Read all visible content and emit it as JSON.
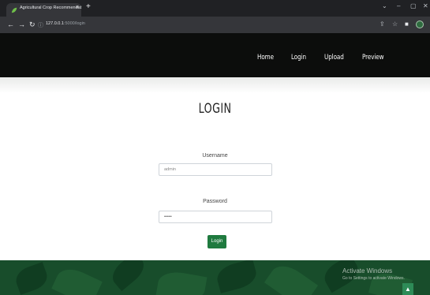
{
  "browser": {
    "tab_title": "Agricultural Crop Recommendat",
    "tab_close": "×",
    "new_tab": "+",
    "url_host": "127.0.0.1",
    "url_path": ":5000/login",
    "window_controls": {
      "chevron": "⌄",
      "minimize": "–",
      "restore": "▢",
      "close": "✕"
    }
  },
  "navbar": {
    "items": [
      {
        "label": "Home"
      },
      {
        "label": "Login"
      },
      {
        "label": "Upload"
      },
      {
        "label": "Preview"
      }
    ]
  },
  "login": {
    "title": "LOGIN",
    "username_label": "Username",
    "username_value": "admin",
    "password_label": "Password",
    "password_value": "•••••",
    "submit_label": "Login"
  },
  "watermark": {
    "line1": "Activate Windows",
    "line2": "Go to Settings to activate Windows."
  },
  "colors": {
    "navbar_bg": "#0c0d0c",
    "button_green": "#1f7a3f",
    "footer_green": "#184d2b"
  }
}
